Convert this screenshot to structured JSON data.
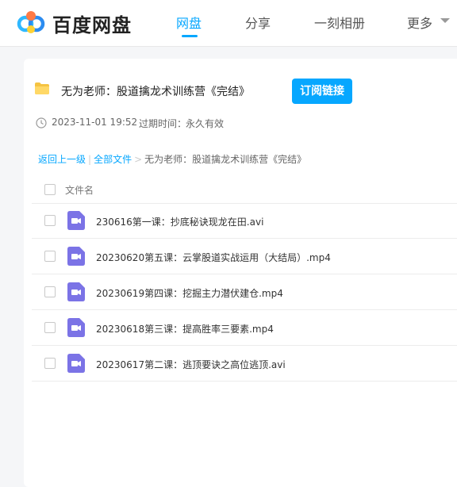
{
  "header": {
    "brand": "百度网盘",
    "nav": [
      {
        "label": "网盘"
      },
      {
        "label": "分享"
      },
      {
        "label": "一刻相册"
      },
      {
        "label": "更多"
      }
    ]
  },
  "share": {
    "title": "无为老师：股道擒龙术训练营《完结》",
    "subscribe_label": "订阅链接",
    "date": "2023-11-01 19:52",
    "expire_label": "过期时间：",
    "expire_value": "永久有效"
  },
  "breadcrumb": {
    "back": "返回上一级",
    "all": "全部文件",
    "current": "无为老师：股道擒龙术训练营《完结》"
  },
  "list": {
    "column_header": "文件名",
    "files": [
      {
        "name": "230616第一课：抄底秘诀现龙在田.avi",
        "icon": "video-file-icon"
      },
      {
        "name": "20230620第五课：云掌股道实战运用（大结局）.mp4",
        "icon": "video-file-icon"
      },
      {
        "name": "20230619第四课：挖掘主力潜伏建仓.mp4",
        "icon": "video-file-icon"
      },
      {
        "name": "20230618第三课：提高胜率三要素.mp4",
        "icon": "video-file-icon"
      },
      {
        "name": "20230617第二课：逃顶要诀之高位逃顶.avi",
        "icon": "video-file-icon"
      }
    ]
  },
  "colors": {
    "accent": "#06a7ff",
    "video_icon": "#7b73e6",
    "folder": "#f5c342"
  }
}
